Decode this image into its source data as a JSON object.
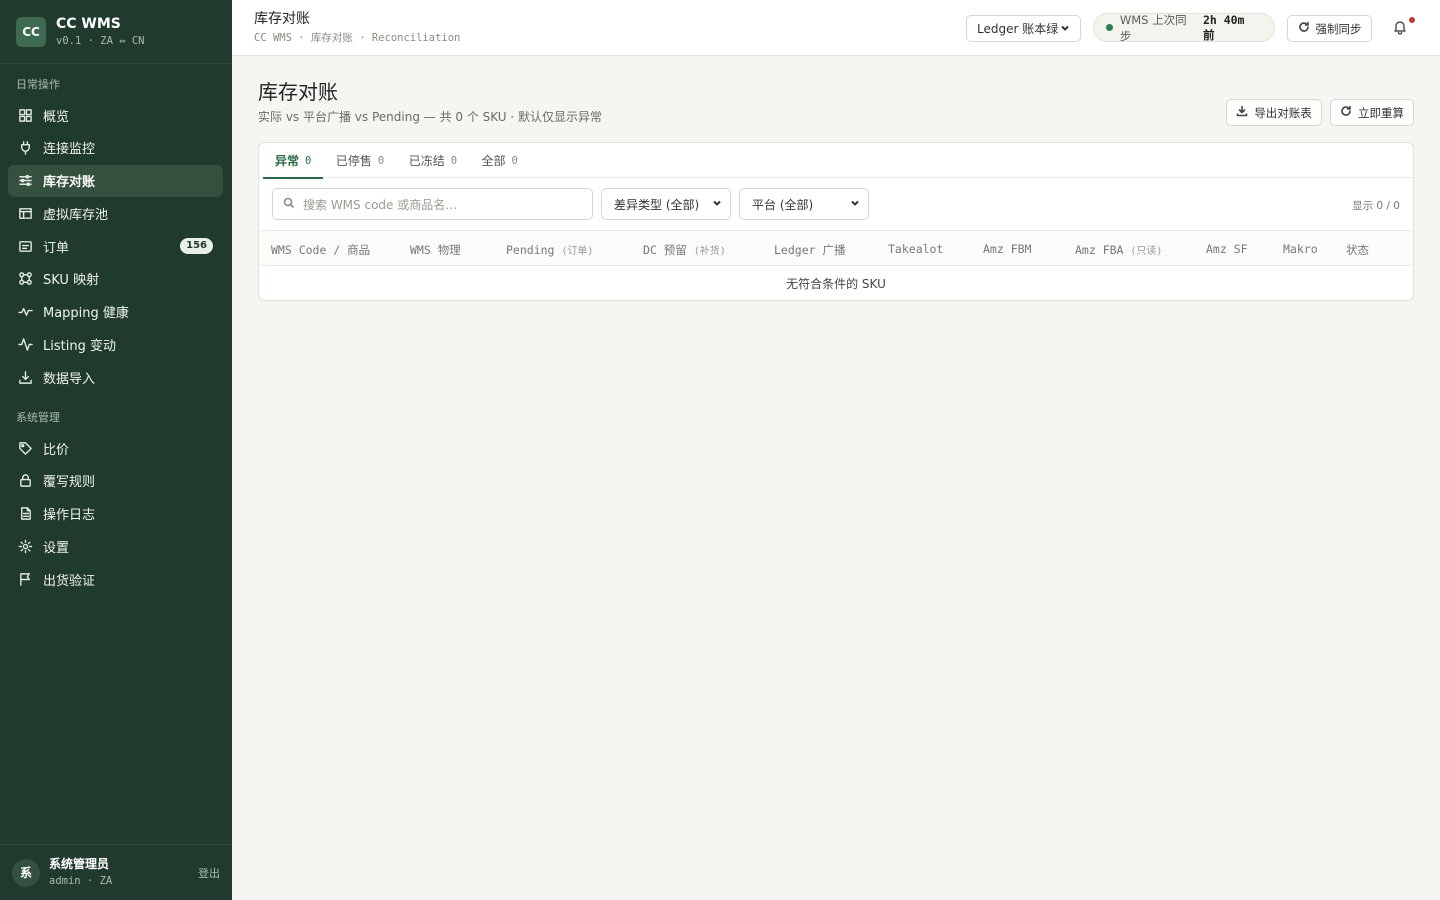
{
  "brand": {
    "logo": "CC",
    "title": "CC WMS",
    "subtitle": "v0.1 · ZA ⇔ CN"
  },
  "nav": {
    "section1": "日常操作",
    "items1": [
      {
        "label": "概览",
        "icon": "grid-icon"
      },
      {
        "label": "连接监控",
        "icon": "plug-icon"
      },
      {
        "label": "库存对账",
        "icon": "sliders-icon",
        "active": true
      },
      {
        "label": "虚拟库存池",
        "icon": "table-icon"
      },
      {
        "label": "订单",
        "icon": "receipt-icon",
        "badge": "156"
      },
      {
        "label": "SKU 映射",
        "icon": "link-icon"
      },
      {
        "label": "Mapping 健康",
        "icon": "pulse-icon"
      },
      {
        "label": "Listing 变动",
        "icon": "activity-icon"
      },
      {
        "label": "数据导入",
        "icon": "download-icon"
      }
    ],
    "section2": "系统管理",
    "items2": [
      {
        "label": "比价",
        "icon": "tag-icon"
      },
      {
        "label": "覆写规则",
        "icon": "lock-icon"
      },
      {
        "label": "操作日志",
        "icon": "file-icon"
      },
      {
        "label": "设置",
        "icon": "gear-icon"
      },
      {
        "label": "出货验证",
        "icon": "flag-icon"
      }
    ]
  },
  "user": {
    "avatar": "系",
    "name": "系统管理员",
    "sub": "admin · ZA",
    "logout": "登出"
  },
  "topbar": {
    "title": "库存对账",
    "breadcrumb": "CC WMS · 库存对账 · Reconciliation",
    "ledger_select": "Ledger 账本绿",
    "sync_label": "WMS 上次同步",
    "sync_time": "2h 40m 前",
    "force_sync": "强制同步"
  },
  "page": {
    "title": "库存对账",
    "subtitle": "实际 vs 平台广播 vs Pending — 共 0 个 SKU · 默认仅显示异常",
    "export_btn": "导出对账表",
    "recalc_btn": "立即重算"
  },
  "tabs": [
    {
      "label": "异常",
      "count": "0",
      "active": true
    },
    {
      "label": "已停售",
      "count": "0"
    },
    {
      "label": "已冻结",
      "count": "0"
    },
    {
      "label": "全部",
      "count": "0"
    }
  ],
  "filters": {
    "search_placeholder": "搜索 WMS code 或商品名…",
    "diff_type": "差异类型 (全部)",
    "platform": "平台 (全部)",
    "shown": "显示 0 / 0"
  },
  "table": {
    "columns": [
      "WMS Code / 商品",
      "WMS 物理",
      "Pending",
      "(订单)",
      "DC 预留",
      "(补货)",
      "Ledger 广播",
      "Takealot",
      "Amz FBM",
      "Amz FBA",
      "(只读)",
      "Amz SF",
      "Makro",
      "状态"
    ],
    "empty": "无符合条件的 SKU"
  }
}
